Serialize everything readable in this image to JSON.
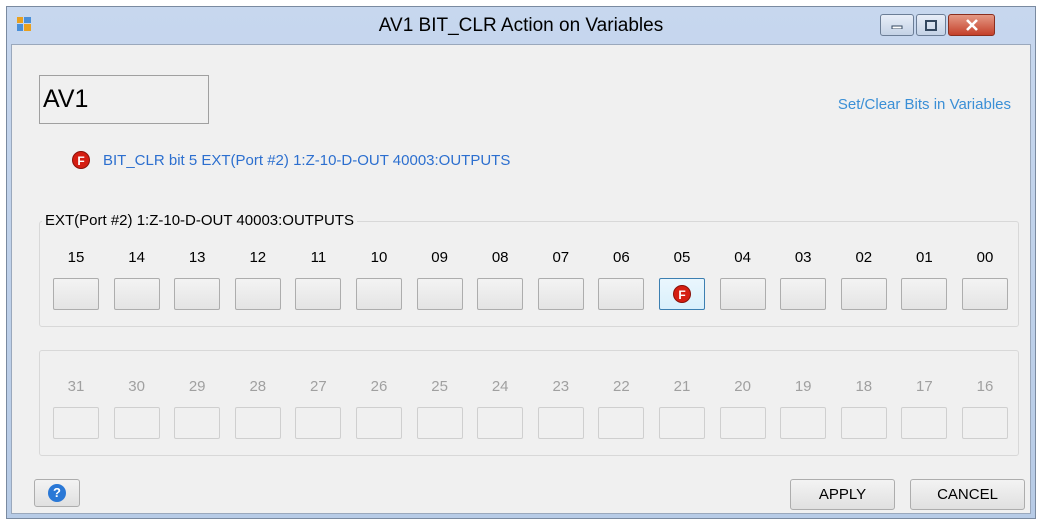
{
  "window": {
    "title": "AV1 BIT_CLR Action on Variables"
  },
  "variable_name": "AV1",
  "help_link": "Set/Clear Bits in Variables",
  "action": {
    "icon_letter": "F",
    "text": "BIT_CLR bit 5 EXT(Port #2) 1:Z-10-D-OUT 40003:OUTPUTS"
  },
  "group_low": {
    "legend": "EXT(Port #2) 1:Z-10-D-OUT 40003:OUTPUTS",
    "bits": [
      "15",
      "14",
      "13",
      "12",
      "11",
      "10",
      "09",
      "08",
      "07",
      "06",
      "05",
      "04",
      "03",
      "02",
      "01",
      "00"
    ],
    "active_bit": "05",
    "active_icon_letter": "F"
  },
  "group_high": {
    "bits": [
      "31",
      "30",
      "29",
      "28",
      "27",
      "26",
      "25",
      "24",
      "23",
      "22",
      "21",
      "20",
      "19",
      "18",
      "17",
      "16"
    ]
  },
  "buttons": {
    "help_glyph": "?",
    "apply": "APPLY",
    "cancel": "CANCEL"
  },
  "colors": {
    "flag_red": "#d51e12",
    "link_blue": "#3a8fd6",
    "action_text_blue": "#2c6fcf",
    "help_blue": "#2a78d6"
  },
  "icons": {
    "app": "app-icon",
    "flag": "flag-f-icon",
    "help": "help-icon"
  }
}
